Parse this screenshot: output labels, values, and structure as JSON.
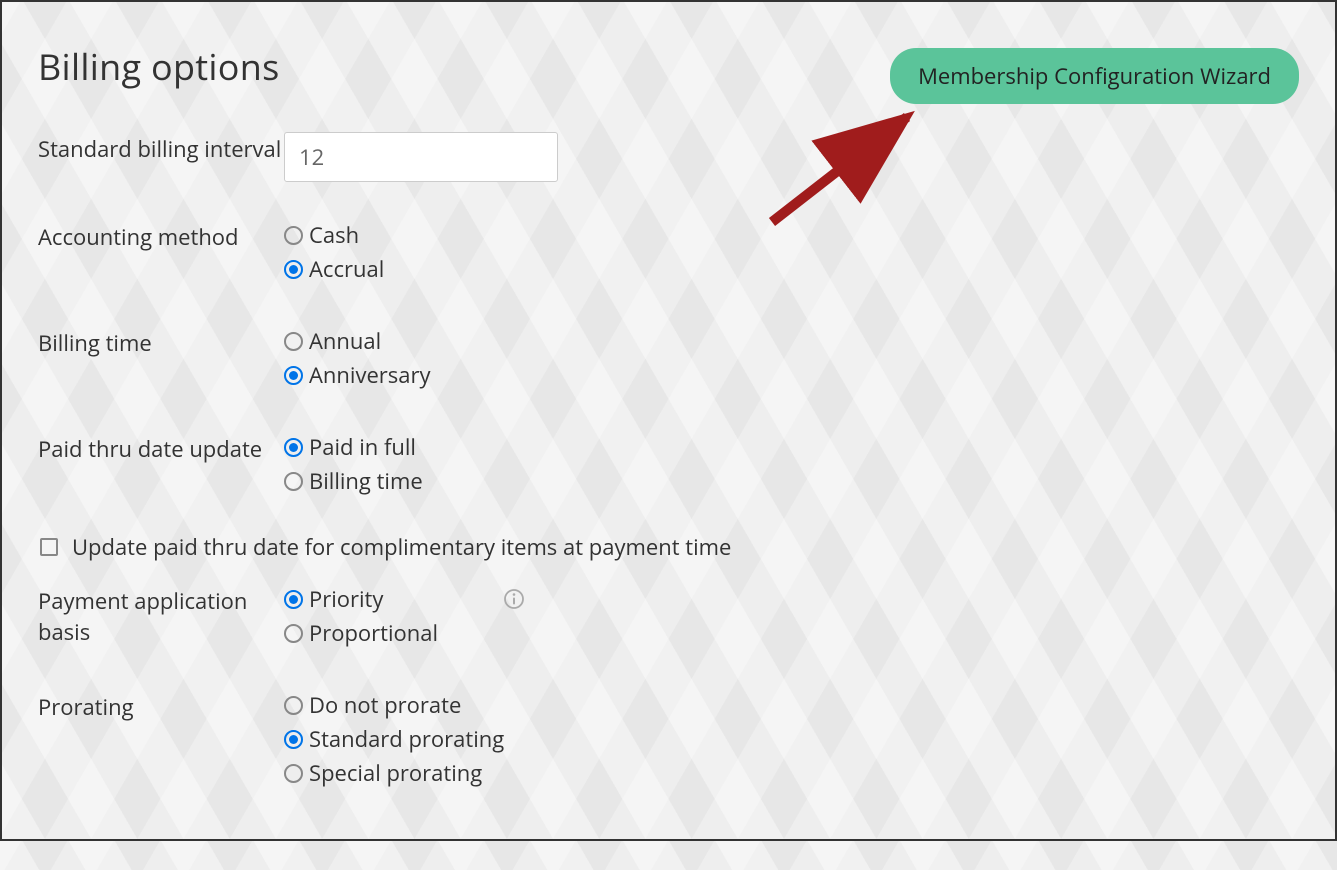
{
  "title": "Billing options",
  "wizard_button": "Membership Configuration Wizard",
  "fields": {
    "standard_billing_interval": {
      "label": "Standard billing interval",
      "value": "12"
    },
    "accounting_method": {
      "label": "Accounting method",
      "options": {
        "cash": "Cash",
        "accrual": "Accrual"
      },
      "selected": "accrual"
    },
    "billing_time": {
      "label": "Billing time",
      "options": {
        "annual": "Annual",
        "anniversary": "Anniversary"
      },
      "selected": "anniversary"
    },
    "paid_thru_date_update": {
      "label": "Paid thru date update",
      "options": {
        "paid_in_full": "Paid in full",
        "billing_time": "Billing time"
      },
      "selected": "paid_in_full"
    },
    "update_paid_thru_checkbox": {
      "label": "Update paid thru date for complimentary items at payment time",
      "checked": false
    },
    "payment_application_basis": {
      "label": "Payment application basis",
      "options": {
        "priority": "Priority",
        "proportional": "Proportional"
      },
      "selected": "priority"
    },
    "prorating": {
      "label": "Prorating",
      "options": {
        "do_not_prorate": "Do not prorate",
        "standard_prorating": "Standard prorating",
        "special_prorating": "Special prorating"
      },
      "selected": "standard_prorating"
    }
  }
}
